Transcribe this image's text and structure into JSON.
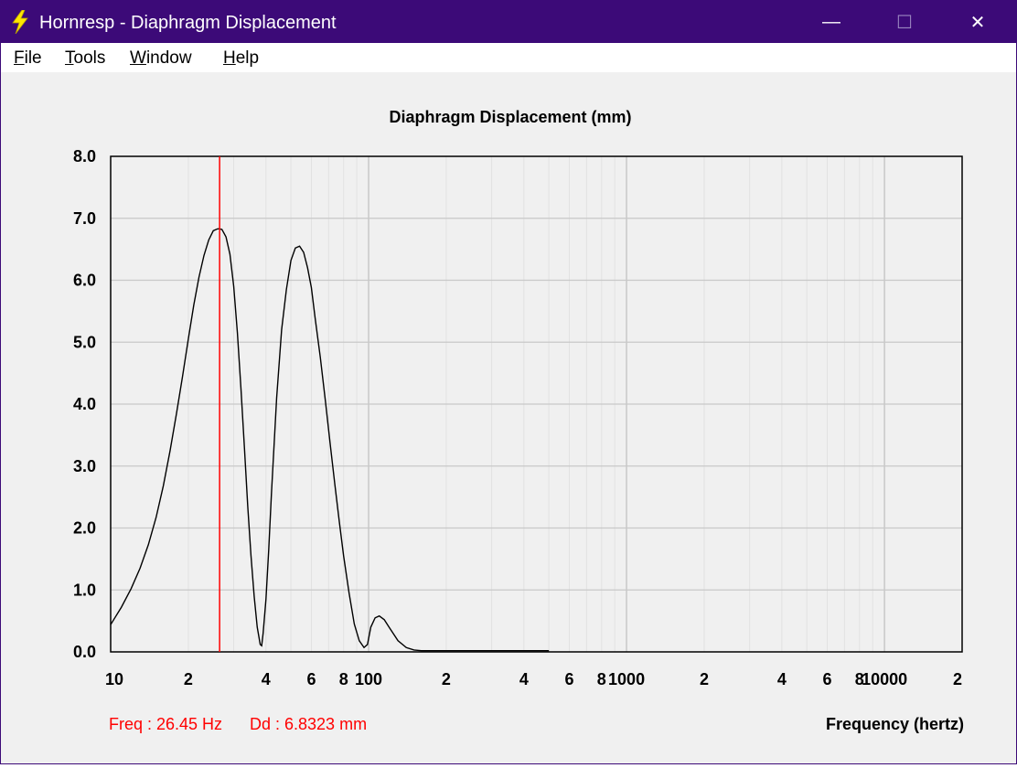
{
  "window": {
    "title": "Hornresp - Diaphragm Displacement",
    "controls": {
      "minimize": "—",
      "maximize": "☐",
      "close": "✕"
    }
  },
  "menu": [
    {
      "label": "File"
    },
    {
      "label": "Tools"
    },
    {
      "label": "Window"
    },
    {
      "label": "Help"
    }
  ],
  "status": {
    "freq_text": "Freq : 26.45 Hz",
    "dd_text": "Dd : 6.8323 mm",
    "color": "#ff0000"
  },
  "chart_data": {
    "type": "line",
    "title": "Diaphragm Displacement (mm)",
    "xlabel": "Frequency (hertz)",
    "ylabel": "",
    "x_scale": "log",
    "xlim": [
      10,
      20000
    ],
    "ylim": [
      0,
      8
    ],
    "grid": true,
    "y_ticks": [
      "0.0",
      "1.0",
      "2.0",
      "3.0",
      "4.0",
      "5.0",
      "6.0",
      "7.0",
      "8.0"
    ],
    "x_ticks": [
      {
        "value": 10,
        "label": "10"
      },
      {
        "value": 20,
        "label": "2"
      },
      {
        "value": 40,
        "label": "4"
      },
      {
        "value": 60,
        "label": "6"
      },
      {
        "value": 80,
        "label": "8"
      },
      {
        "value": 100,
        "label": "100"
      },
      {
        "value": 200,
        "label": "2"
      },
      {
        "value": 400,
        "label": "4"
      },
      {
        "value": 600,
        "label": "6"
      },
      {
        "value": 800,
        "label": "8"
      },
      {
        "value": 1000,
        "label": "1000"
      },
      {
        "value": 2000,
        "label": "2"
      },
      {
        "value": 4000,
        "label": "4"
      },
      {
        "value": 6000,
        "label": "6"
      },
      {
        "value": 8000,
        "label": "8"
      },
      {
        "value": 10000,
        "label": "10000"
      },
      {
        "value": 20000,
        "label": "2"
      }
    ],
    "line_color": "#000000",
    "cursor": {
      "x": 26.45,
      "y": 6.8323,
      "color": "#ff0000"
    },
    "series": [
      {
        "x": [
          10,
          11,
          12,
          13,
          14,
          15,
          16,
          17,
          18,
          19,
          20,
          21,
          22,
          23,
          24,
          25,
          26,
          26.45,
          27,
          28,
          29,
          30,
          31,
          32,
          33,
          34,
          35,
          36,
          37,
          38,
          38.5,
          39,
          40,
          41,
          42,
          44,
          46,
          48,
          50,
          52,
          54,
          56,
          58,
          60,
          62,
          65,
          68,
          71,
          74,
          77,
          80,
          84,
          88,
          92,
          96,
          99,
          102,
          106,
          110,
          115,
          120,
          130,
          140,
          150,
          160,
          170,
          200,
          300,
          400,
          500
        ],
        "y": [
          0.44,
          0.72,
          1.02,
          1.35,
          1.73,
          2.17,
          2.68,
          3.25,
          3.85,
          4.45,
          5.05,
          5.6,
          6.05,
          6.4,
          6.65,
          6.8,
          6.83,
          6.83,
          6.82,
          6.7,
          6.42,
          5.9,
          5.15,
          4.25,
          3.3,
          2.35,
          1.55,
          0.9,
          0.4,
          0.12,
          0.1,
          0.3,
          0.85,
          1.65,
          2.55,
          4.1,
          5.2,
          5.85,
          6.32,
          6.52,
          6.55,
          6.45,
          6.2,
          5.88,
          5.4,
          4.75,
          4.05,
          3.35,
          2.7,
          2.1,
          1.55,
          0.95,
          0.45,
          0.18,
          0.07,
          0.12,
          0.4,
          0.55,
          0.58,
          0.52,
          0.4,
          0.18,
          0.07,
          0.03,
          0.02,
          0.02,
          0.02,
          0.02,
          0.02,
          0.02
        ]
      }
    ]
  }
}
